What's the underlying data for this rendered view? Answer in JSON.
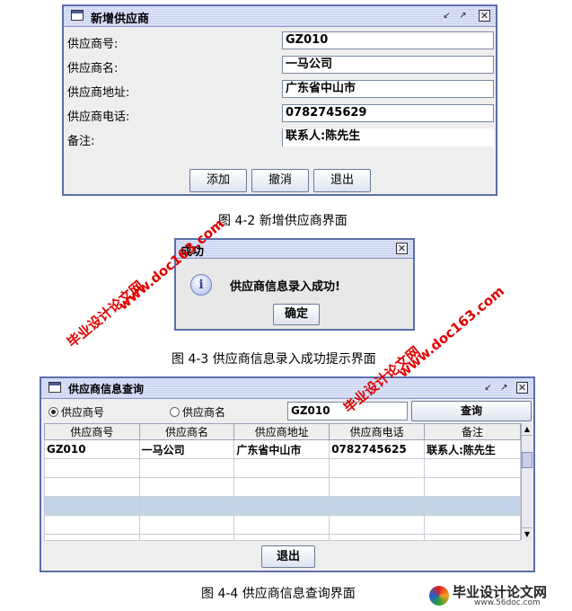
{
  "window1": {
    "title": "新增供应商",
    "labels": [
      "供应商号:",
      "供应商名:",
      "供应商地址:",
      "供应商电话:",
      "备注:"
    ],
    "values": [
      "GZ010",
      "一马公司",
      "广东省中山市",
      "0782745629",
      "联系人:陈先生"
    ],
    "buttons": {
      "add": "添加",
      "undo": "撤消",
      "exit": "退出"
    }
  },
  "caption1": "图 4-2 新增供应商界面",
  "dialog": {
    "title": "成功",
    "message": "供应商信息录入成功!",
    "ok": "确定",
    "info_icon": "i"
  },
  "caption2": "图 4-3 供应商信息录入成功提示界面",
  "window2": {
    "title": "供应商信息查询",
    "radio_id": "供应商号",
    "radio_name": "供应商名",
    "search_value": "GZ010",
    "search_button": "查询",
    "columns": [
      "供应商号",
      "供应商名",
      "供应商地址",
      "供应商电话",
      "备注"
    ],
    "rows": [
      [
        "GZ010",
        "一马公司",
        "广东省中山市",
        "0782745625",
        "联系人:陈先生"
      ]
    ],
    "exit": "退出"
  },
  "caption3": "图 4-4 供应商信息查询界面",
  "watermarks": {
    "site": "www.doc163.com",
    "cn": "毕业设计论文网",
    "footer_cn": "毕业设计论文网",
    "footer_site": "www.56doc.com"
  },
  "colors": {
    "frame": "#5a6ea8",
    "watermark": "#e00000",
    "selected_row": "#c4d4e8"
  }
}
